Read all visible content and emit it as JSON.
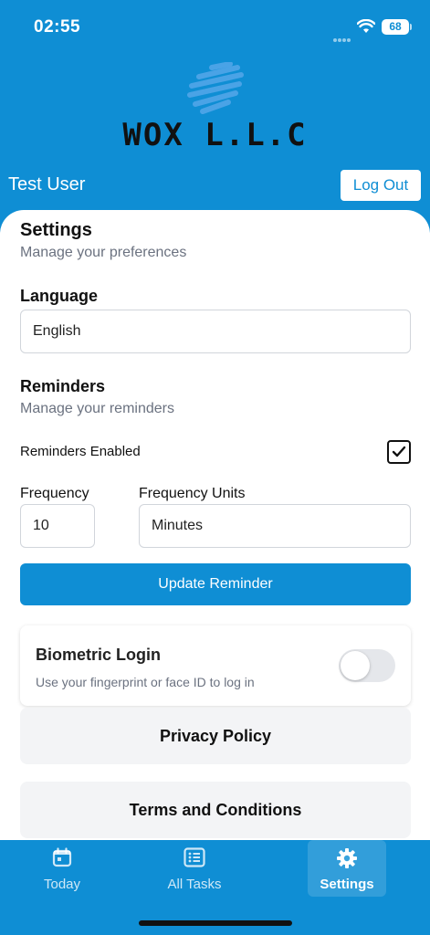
{
  "status_bar": {
    "time": "02:55",
    "battery": "68"
  },
  "header": {
    "logo_text": "WOX L.L.C",
    "user_name": "Test User",
    "logout_label": "Log Out"
  },
  "settings": {
    "title": "Settings",
    "subtitle": "Manage your preferences"
  },
  "language": {
    "label": "Language",
    "value": "English"
  },
  "reminders": {
    "title": "Reminders",
    "subtitle": "Manage your reminders",
    "enabled_label": "Reminders Enabled",
    "enabled": true,
    "frequency_label": "Frequency",
    "frequency_value": "10",
    "units_label": "Frequency Units",
    "units_value": "Minutes",
    "update_label": "Update Reminder"
  },
  "biometric": {
    "title": "Biometric Login",
    "description": "Use your fingerprint or face ID to log in",
    "enabled": false
  },
  "links": {
    "privacy": "Privacy Policy",
    "terms": "Terms and Conditions"
  },
  "tabs": [
    {
      "label": "Today",
      "icon": "calendar-icon"
    },
    {
      "label": "All Tasks",
      "icon": "list-icon"
    },
    {
      "label": "Settings",
      "icon": "gear-icon",
      "active": true
    }
  ],
  "colors": {
    "primary": "#0f8ed4",
    "logo_mark": "#4aa3e6"
  }
}
